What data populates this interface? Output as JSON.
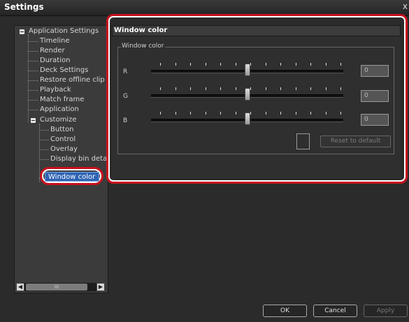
{
  "window": {
    "title": "Settings",
    "close_glyph": "x"
  },
  "tree": {
    "items": [
      {
        "label": "Application Settings",
        "level": 0,
        "expandable": true
      },
      {
        "label": "Timeline",
        "level": 1
      },
      {
        "label": "Render",
        "level": 1
      },
      {
        "label": "Duration",
        "level": 1
      },
      {
        "label": "Deck Settings",
        "level": 1
      },
      {
        "label": "Restore offline clip",
        "level": 1
      },
      {
        "label": "Playback",
        "level": 1
      },
      {
        "label": "Match frame",
        "level": 1
      },
      {
        "label": "Application",
        "level": 1
      },
      {
        "label": "Customize",
        "level": 1,
        "expandable": true
      },
      {
        "label": "Button",
        "level": 2
      },
      {
        "label": "Control",
        "level": 2
      },
      {
        "label": "Overlay",
        "level": 2
      },
      {
        "label": "Display bin details",
        "level": 2
      },
      {
        "label": "Window color",
        "level": 2,
        "selected": true
      }
    ],
    "scrollbar_thumb_glyph": "III"
  },
  "panel": {
    "title": "Window color",
    "group_label": "Window color",
    "sliders": [
      {
        "label": "R",
        "value": "0",
        "position": 0.5
      },
      {
        "label": "G",
        "value": "0",
        "position": 0.5
      },
      {
        "label": "B",
        "value": "0",
        "position": 0.5
      }
    ],
    "reset_label": "Reset to default"
  },
  "footer": {
    "ok": "OK",
    "cancel": "Cancel",
    "apply": "Apply"
  },
  "colors": {
    "selection": "#2f64b4",
    "highlight_ring": "#c8101e",
    "panel_bg": "#2f2f2f"
  }
}
